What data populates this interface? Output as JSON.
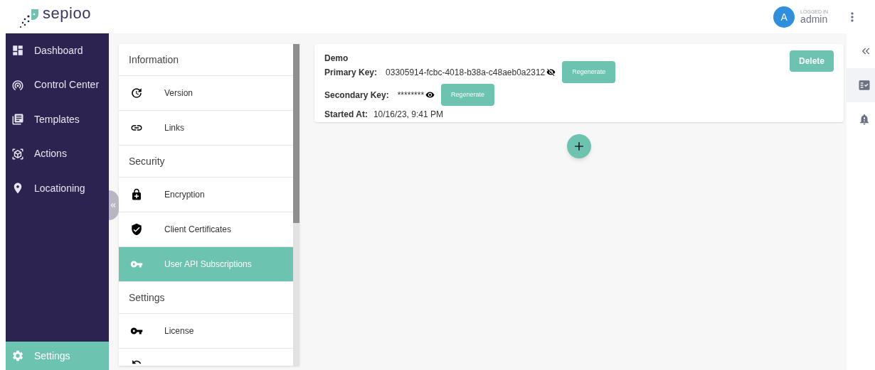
{
  "header": {
    "logo": "sepioo",
    "user": {
      "initial": "A",
      "status": "LOGGED IN",
      "name": "admin"
    }
  },
  "sidebar": {
    "items": [
      {
        "label": "Dashboard",
        "selected": false
      },
      {
        "label": "Control Center",
        "selected": false
      },
      {
        "label": "Templates",
        "selected": false
      },
      {
        "label": "Actions",
        "selected": false
      },
      {
        "label": "Locationing",
        "selected": false
      }
    ],
    "footer_item": {
      "label": "Settings",
      "selected": true
    }
  },
  "settings_menu": [
    {
      "kind": "heading",
      "label": "Information"
    },
    {
      "kind": "item",
      "label": "Version",
      "selected": false
    },
    {
      "kind": "item",
      "label": "Links",
      "selected": false
    },
    {
      "kind": "heading",
      "label": "Security"
    },
    {
      "kind": "item",
      "label": "Encryption",
      "selected": false
    },
    {
      "kind": "item",
      "label": "Client Certificates",
      "selected": false
    },
    {
      "kind": "item",
      "label": "User API Subscriptions",
      "selected": true
    },
    {
      "kind": "heading",
      "label": "Settings"
    },
    {
      "kind": "item",
      "label": "License",
      "selected": false
    }
  ],
  "subscription": {
    "name": "Demo",
    "delete": "Delete",
    "keys": [
      {
        "label": "Primary Key:",
        "value": "03305914-fcbc-4018-b38a-c48aeb0a2312",
        "revealed": true,
        "button": "Regenerate"
      },
      {
        "label": "Secondary Key:",
        "value": "********",
        "revealed": false,
        "button": "Regenerate"
      }
    ],
    "started_label": "Started At:",
    "started_value": "10/16/23, 9:41 PM"
  },
  "right_rail": [
    {
      "selected": true
    },
    {
      "selected": false
    }
  ]
}
